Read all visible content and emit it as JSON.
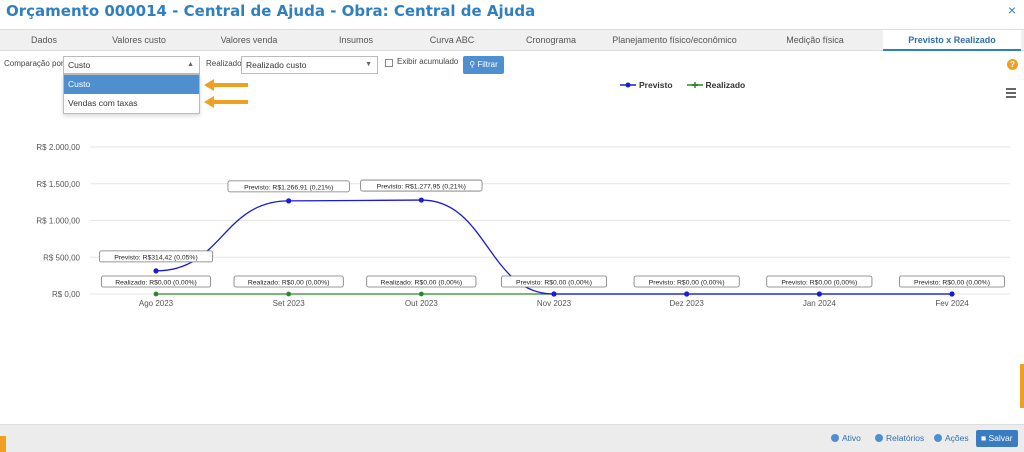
{
  "window": {
    "title": "Orçamento 000014 - Central de Ajuda - Obra: Central de Ajuda",
    "close_glyph": "×"
  },
  "tabs": [
    {
      "label": "Dados"
    },
    {
      "label": "Valores custo"
    },
    {
      "label": "Valores venda"
    },
    {
      "label": "Insumos"
    },
    {
      "label": "Curva ABC"
    },
    {
      "label": "Cronograma"
    },
    {
      "label": "Planejamento físico/econômico"
    },
    {
      "label": "Medição física"
    },
    {
      "label": "Previsto x Realizado"
    }
  ],
  "active_tab": "Previsto x Realizado",
  "filters": {
    "comparacao_label": "Comparação por",
    "comparacao_value": "Custo",
    "comparacao_options": [
      "Custo",
      "Vendas com taxas"
    ],
    "realizado_label": "Realizado",
    "realizado_value": "Realizado custo",
    "exibir_label": "Exibir acumulado",
    "filtrar_label": "Filtrar",
    "help_glyph": "?"
  },
  "legend": {
    "previsto": "Previsto",
    "realizado": "Realizado"
  },
  "colors": {
    "accent": "#2f7fc1",
    "previsto": "#1a1adb",
    "realizado": "#2a8a2a",
    "orange": "#f0a020"
  },
  "chart_data": {
    "type": "line",
    "categories": [
      "Ago 2023",
      "Set 2023",
      "Out 2023",
      "Nov 2023",
      "Dez 2023",
      "Jan 2024",
      "Fev 2024"
    ],
    "ytick_labels": [
      "R$ 0,00",
      "R$ 500,00",
      "R$ 1.000,00",
      "R$ 1.500,00",
      "R$ 2.000,00"
    ],
    "ylim": [
      0,
      2000
    ],
    "series": [
      {
        "name": "Previsto",
        "values": [
          314.42,
          1266.91,
          1277.95,
          0,
          0,
          0,
          0
        ],
        "labels": [
          "Previsto: R$314,42 (0,05%)",
          "Previsto: R$1.266,91 (0,21%)",
          "Previsto: R$1.277,95 (0,21%)",
          "Previsto: R$0,00 (0,00%)",
          "Previsto: R$0,00 (0,00%)",
          "Previsto: R$0,00 (0,00%)",
          "Previsto: R$0,00 (0,00%)"
        ]
      },
      {
        "name": "Realizado",
        "values": [
          0,
          0,
          0,
          0,
          0,
          0,
          0
        ],
        "labels": [
          "Realizado: R$0,00 (0,00%)",
          "Realizado: R$0,00 (0,00%)",
          "Realizado: R$0,00 (0,00%)",
          "",
          "",
          "",
          ""
        ]
      }
    ]
  },
  "bottom": {
    "ativo": "Ativo",
    "relatorios": "Relatórios",
    "acoes": "Ações",
    "salvar": "Salvar"
  }
}
